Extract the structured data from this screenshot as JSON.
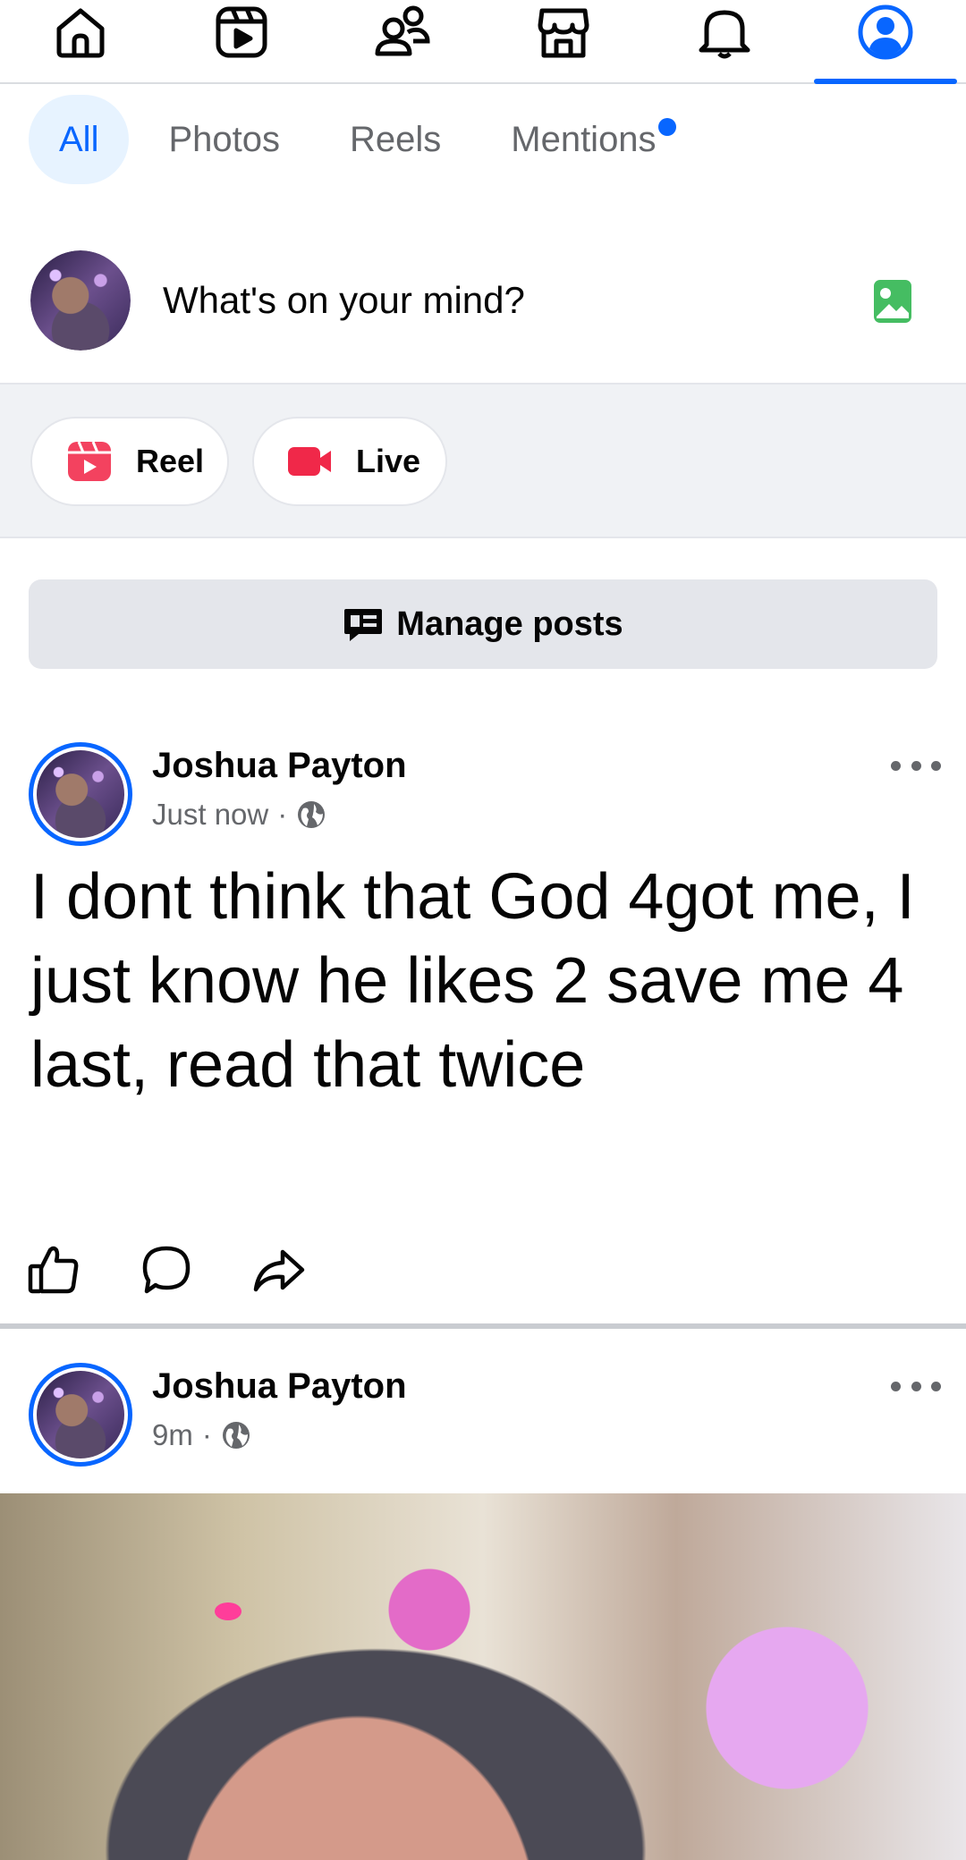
{
  "nav": {
    "tabs": [
      {
        "name": "home",
        "icon": "home-icon"
      },
      {
        "name": "video",
        "icon": "video-icon"
      },
      {
        "name": "friends",
        "icon": "friends-icon"
      },
      {
        "name": "marketplace",
        "icon": "marketplace-icon"
      },
      {
        "name": "notifications",
        "icon": "bell-icon"
      },
      {
        "name": "profile",
        "icon": "profile-icon",
        "active": true
      }
    ],
    "accent_color": "#0866ff"
  },
  "filters": {
    "chips": [
      {
        "label": "All",
        "active": true
      },
      {
        "label": "Photos"
      },
      {
        "label": "Reels"
      },
      {
        "label": "Mentions",
        "has_dot": true
      }
    ]
  },
  "composer": {
    "prompt": "What's on your mind?",
    "photo_icon": "photo-icon",
    "photo_icon_color": "#45bd62"
  },
  "create": {
    "reel_label": "Reel",
    "live_label": "Live",
    "reel_icon_color": "#f3425f",
    "live_icon_color": "#f02849"
  },
  "manage_posts": {
    "label": "Manage posts"
  },
  "posts": [
    {
      "author": "Joshua Payton",
      "time": "Just now",
      "separator": "·",
      "audience_icon": "globe-icon",
      "text": "I dont think that God 4got me, I just know he likes 2 save me 4 last, read that twice"
    },
    {
      "author": "Joshua Payton",
      "time": "9m",
      "separator": "·",
      "audience_icon": "globe-icon"
    }
  ]
}
